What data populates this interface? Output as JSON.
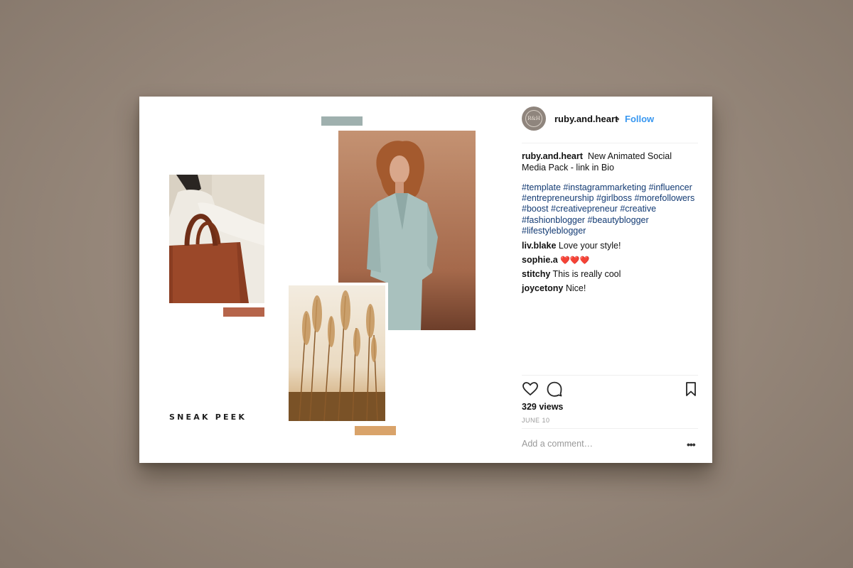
{
  "post": {
    "collage_text": "SNEAK PEEK",
    "swatch_colors": {
      "teal": "#9fb0ae",
      "rust": "#b5644a",
      "ochre": "#d9a36a"
    }
  },
  "header": {
    "username": "ruby.and.heart",
    "separator": "•",
    "follow_label": "Follow",
    "avatar_monogram": "R&H"
  },
  "caption": {
    "username": "ruby.and.heart",
    "text": "New Animated Social Media Pack - link in Bio"
  },
  "hashtags": [
    "#template",
    "#instagrammarketing",
    "#influencer",
    "#entrepreneurship",
    "#girlboss",
    "#morefollowers",
    "#boost",
    "#creativepreneur",
    "#creative",
    "#fashionblogger",
    "#beautyblogger",
    "#lifestyleblogger"
  ],
  "comments": [
    {
      "user": "liv.blake",
      "text": "Love your style!"
    },
    {
      "user": "sophie.a",
      "text": "❤️❤️❤️"
    },
    {
      "user": "stitchy",
      "text": "This is really cool"
    },
    {
      "user": "joycetony",
      "text": "Nice!"
    }
  ],
  "stats": {
    "views": "329 views",
    "date": "JUNE 10"
  },
  "comment_box": {
    "placeholder": "Add a comment…",
    "more_label": "•••"
  },
  "icons": {
    "like": "heart-icon",
    "comment": "comment-bubble-icon",
    "save": "bookmark-icon",
    "more": "more-options-icon"
  }
}
